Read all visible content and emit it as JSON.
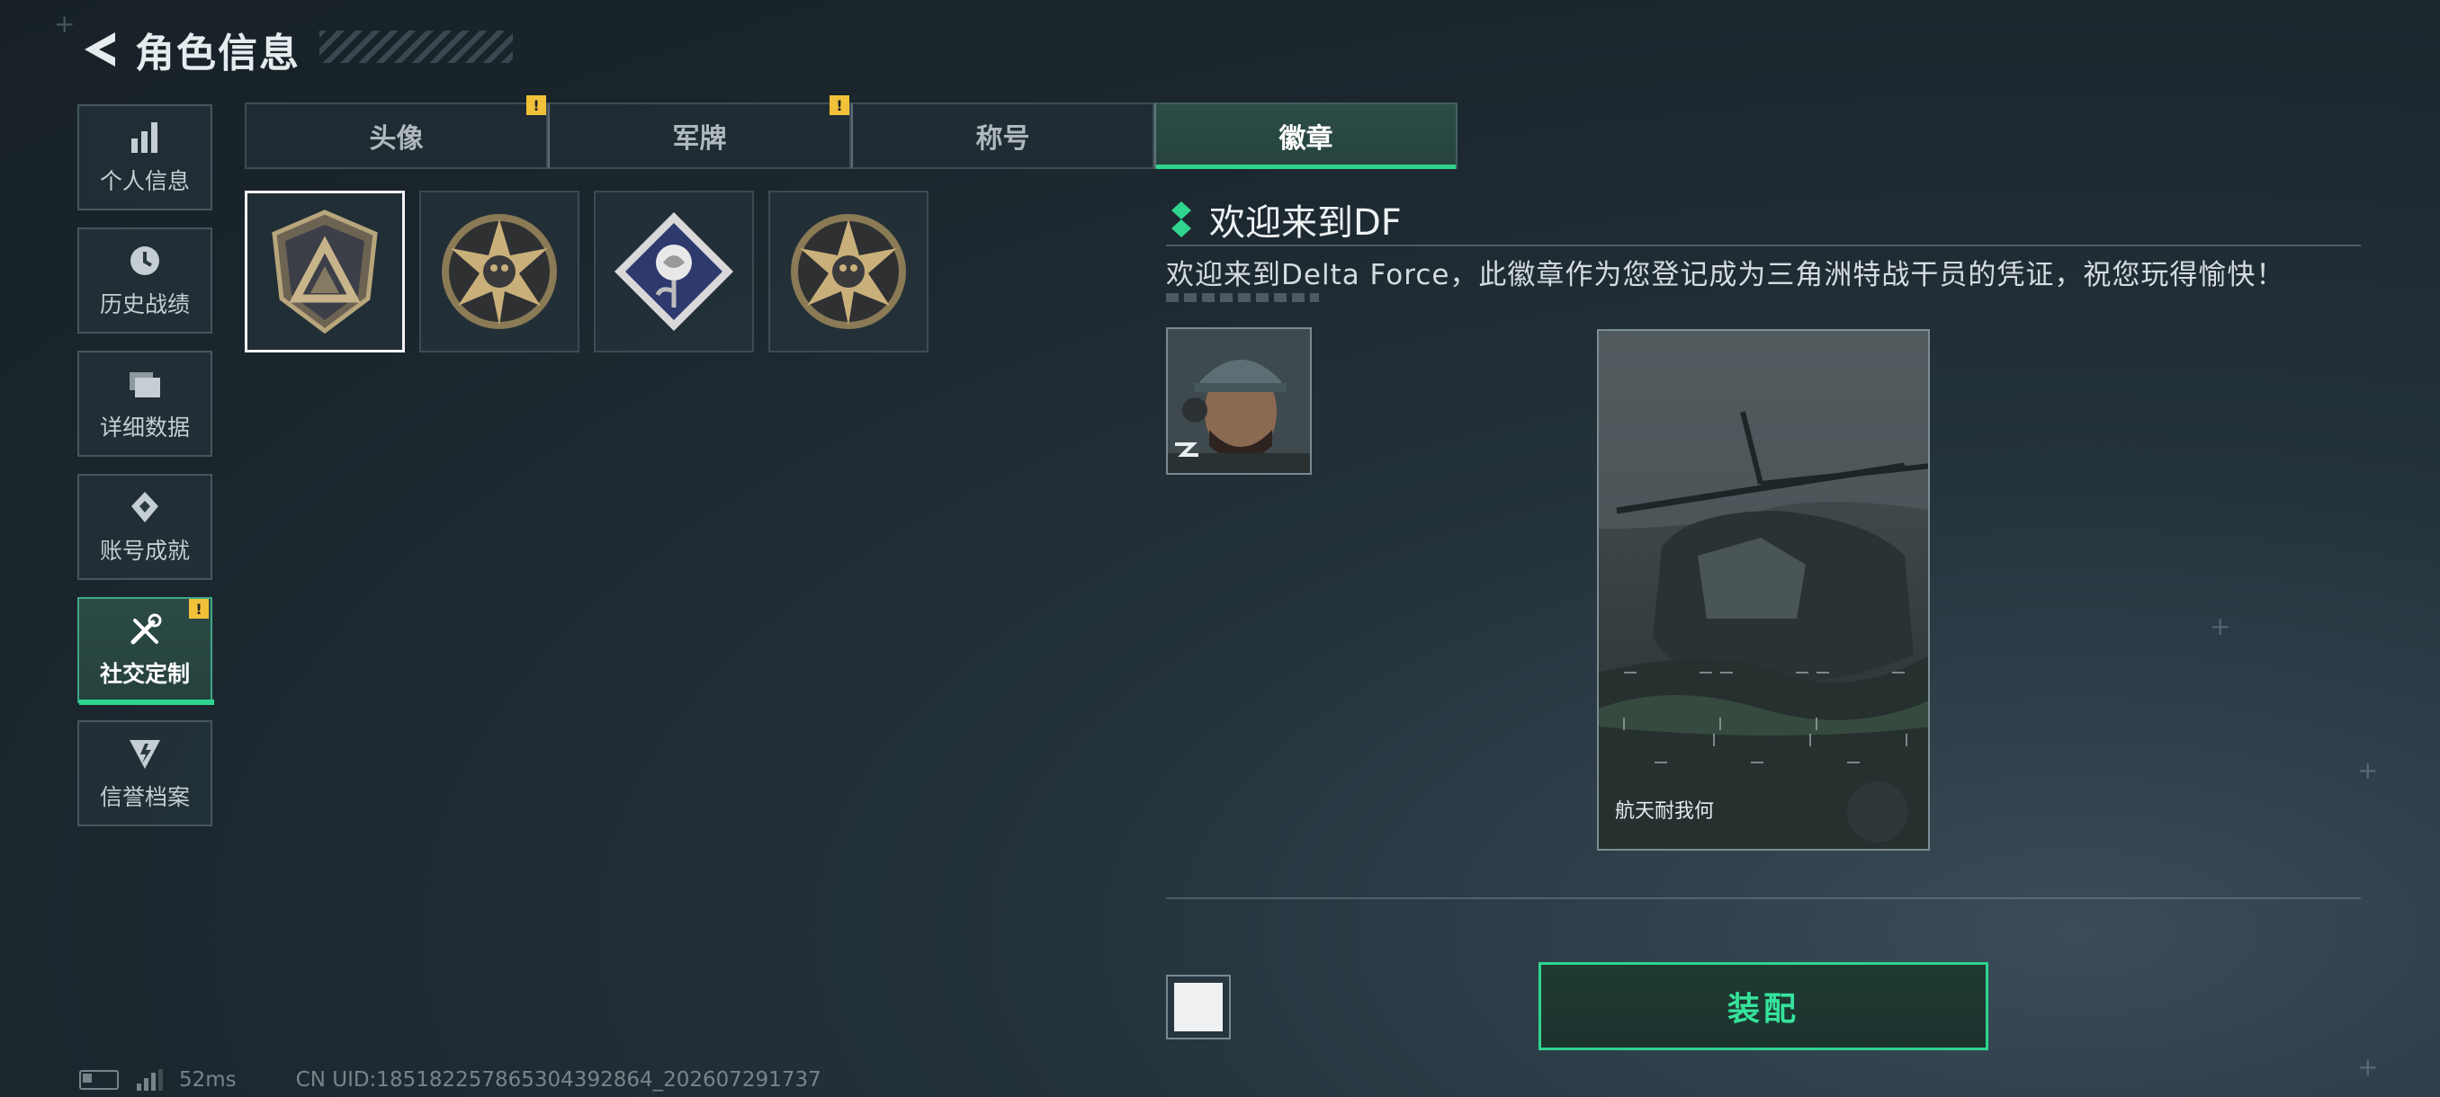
{
  "header": {
    "title": "角色信息"
  },
  "sidebar": {
    "items": [
      {
        "label": "个人信息",
        "icon": "bar-chart-icon",
        "active": false
      },
      {
        "label": "历史战绩",
        "icon": "clock-icon",
        "active": false
      },
      {
        "label": "详细数据",
        "icon": "folder-icon",
        "active": false
      },
      {
        "label": "账号成就",
        "icon": "achievement-icon",
        "active": false
      },
      {
        "label": "社交定制",
        "icon": "tools-icon",
        "active": true,
        "alert": "!"
      },
      {
        "label": "信誉档案",
        "icon": "reputation-icon",
        "active": false
      }
    ]
  },
  "tabs": [
    {
      "label": "头像",
      "alert": "!"
    },
    {
      "label": "军牌",
      "alert": "!"
    },
    {
      "label": "称号"
    },
    {
      "label": "徽章",
      "active": true
    }
  ],
  "badges": [
    {
      "name": "delta-shield-badge",
      "selected": true
    },
    {
      "name": "gold-star-badge"
    },
    {
      "name": "rose-diamond-badge"
    },
    {
      "name": "gold-star-badge"
    }
  ],
  "detail": {
    "title": "欢迎来到DF",
    "description": "欢迎来到Delta Force，此徽章作为您登记成为三角洲特战干员的凭证，祝您玩得愉快！",
    "card_label": "航天耐我何"
  },
  "actions": {
    "equip_label": "装配"
  },
  "status": {
    "ping": "52ms",
    "uid": "CN UID:18518225786530439​2864_202607291737"
  },
  "colors": {
    "accent": "#2fd48f",
    "warning": "#f2c13a",
    "background": "#1b262d"
  }
}
